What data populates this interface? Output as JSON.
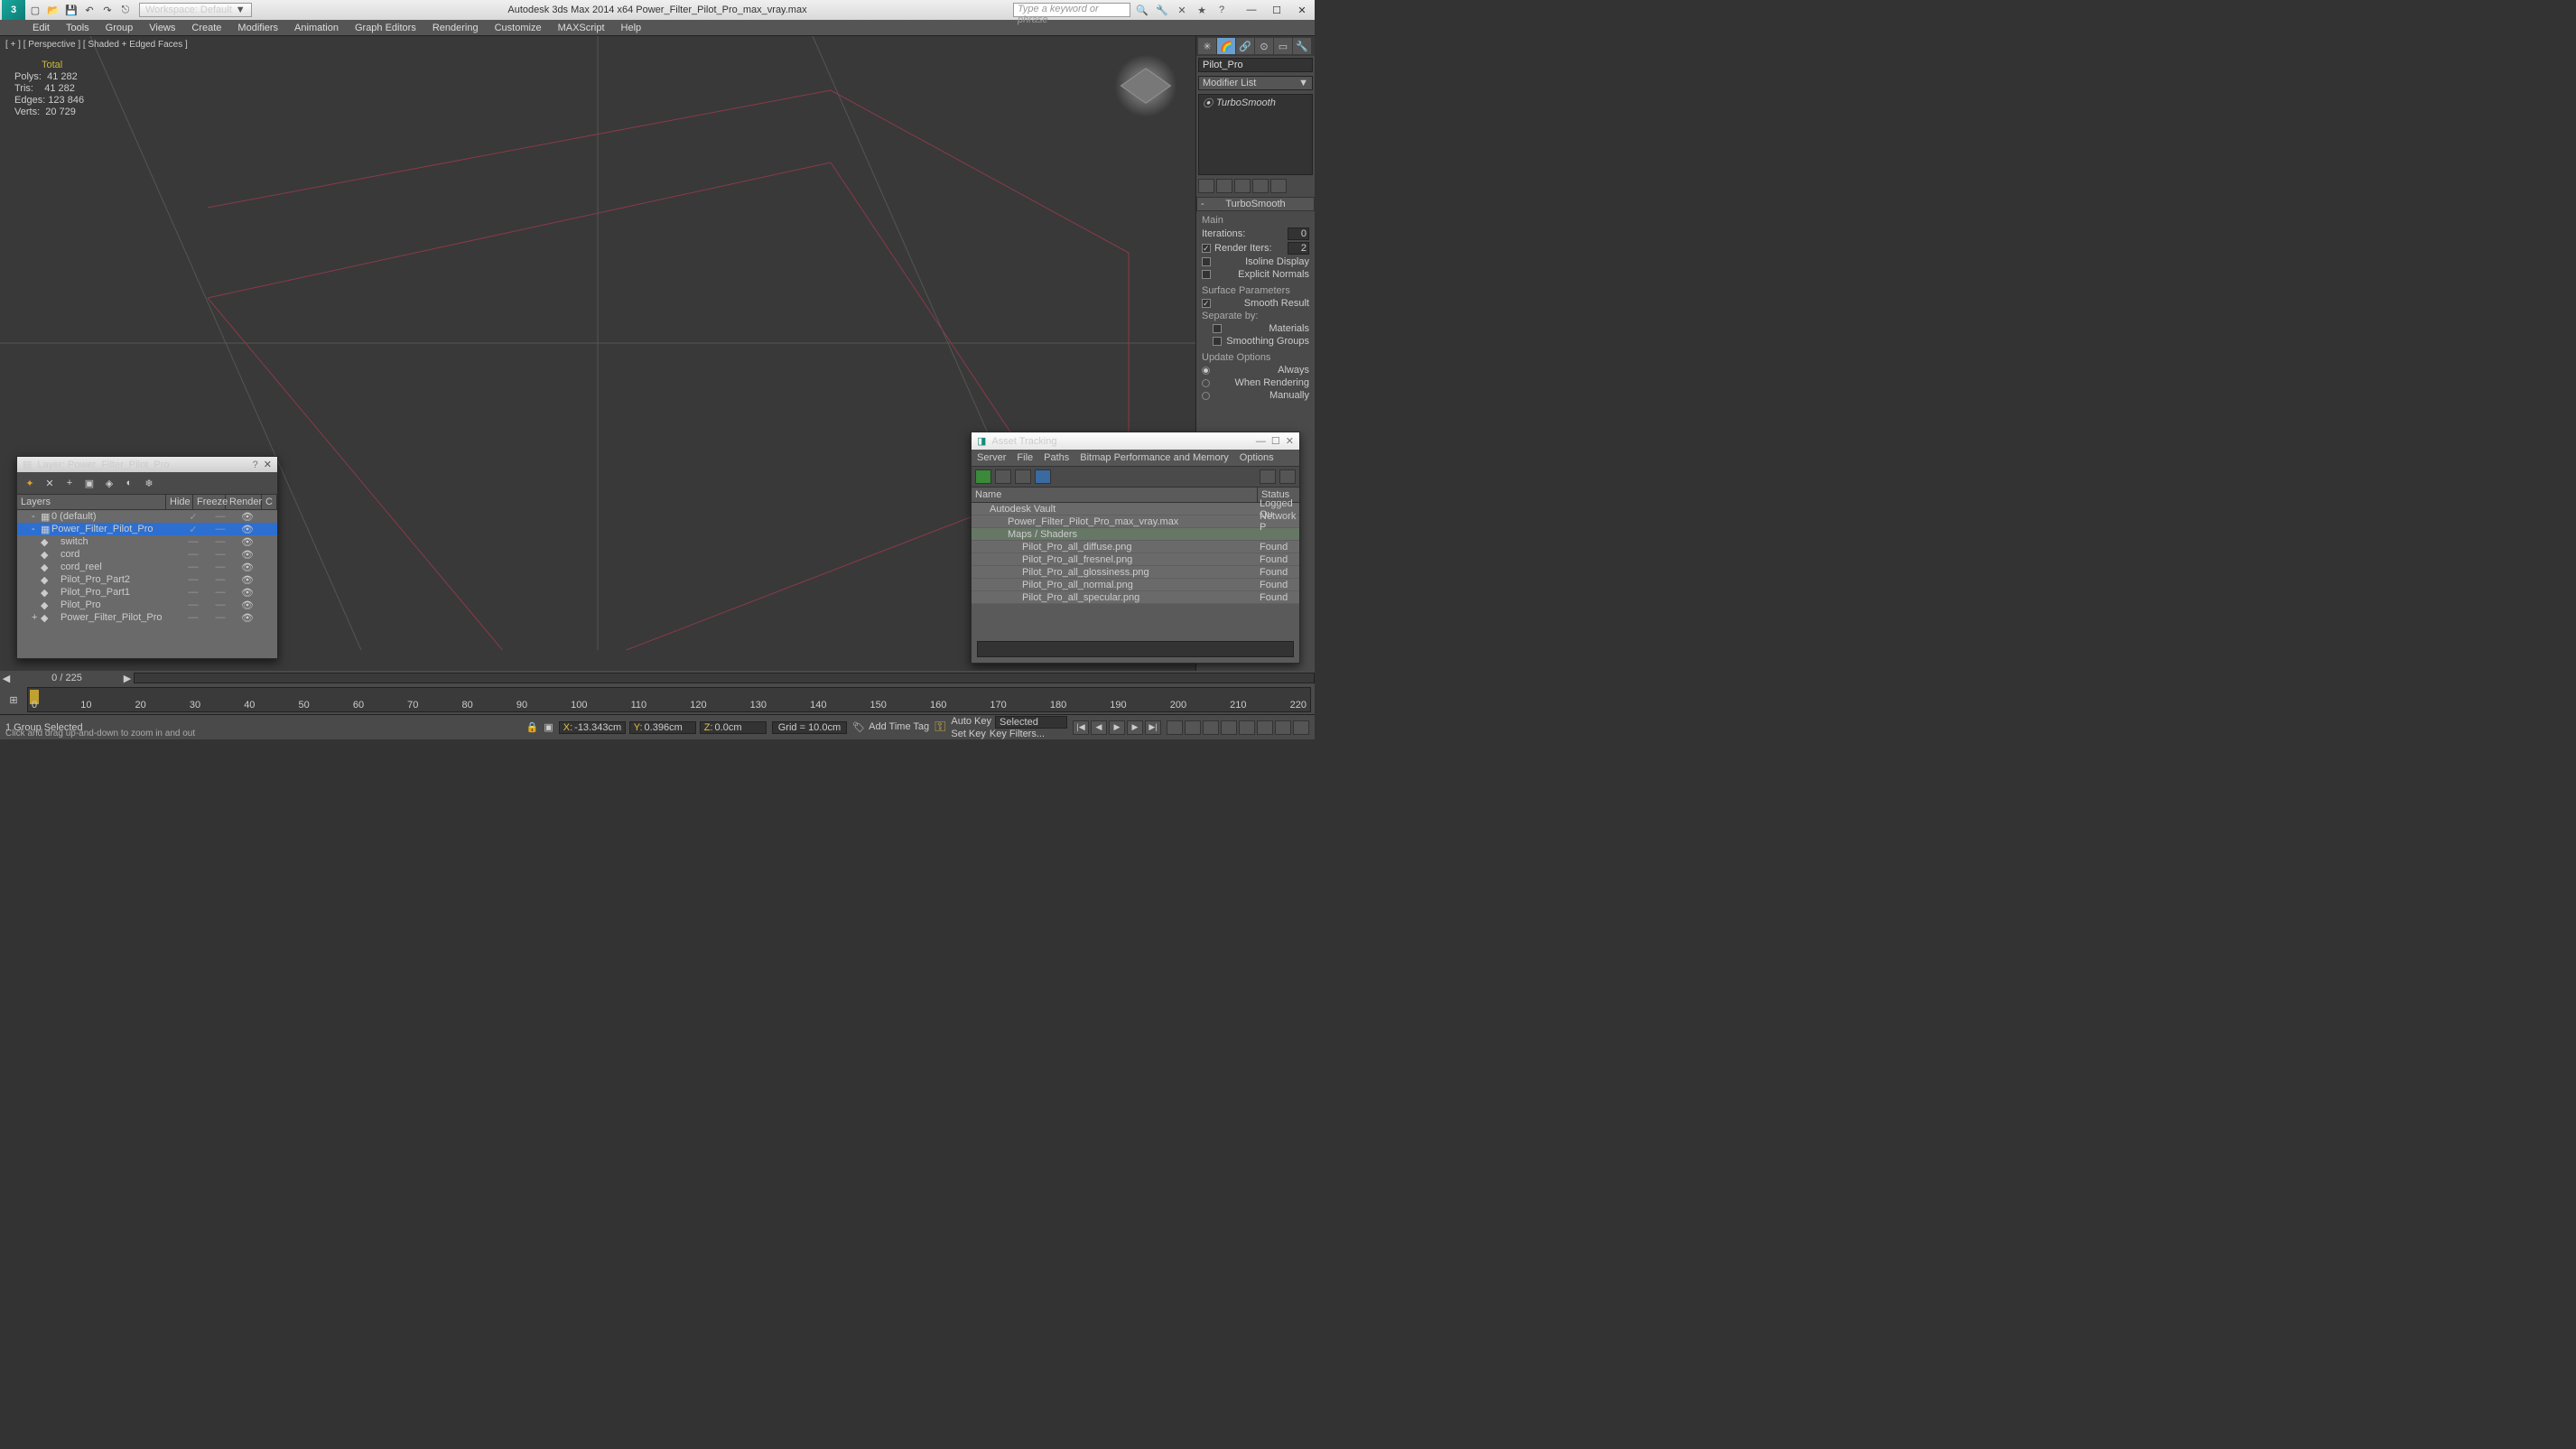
{
  "titlebar": {
    "workspace_label": "Workspace: Default",
    "center_title": "Autodesk 3ds Max  2014 x64    Power_Filter_Pilot_Pro_max_vray.max",
    "search_placeholder": "Type a keyword or phrase"
  },
  "menu": [
    "Edit",
    "Tools",
    "Group",
    "Views",
    "Create",
    "Modifiers",
    "Animation",
    "Graph Editors",
    "Rendering",
    "Customize",
    "MAXScript",
    "Help"
  ],
  "viewport": {
    "label": "[ + ] [ Perspective ] [ Shaded + Edged Faces ]",
    "stats_header": "Total",
    "stats": [
      {
        "k": "Polys:",
        "v": "41 282"
      },
      {
        "k": "Tris:",
        "v": "41 282"
      },
      {
        "k": "Edges:",
        "v": "123 846"
      },
      {
        "k": "Verts:",
        "v": "20 729"
      }
    ]
  },
  "cmd": {
    "object_name": "Pilot_Pro",
    "modifier_list_label": "Modifier List",
    "stack_item": "TurboSmooth",
    "rollout_title": "TurboSmooth",
    "group_main": "Main",
    "iterations_label": "Iterations:",
    "iterations_value": "0",
    "render_iters_label": "Render Iters:",
    "render_iters_value": "2",
    "isoline_label": "Isoline Display",
    "explicit_label": "Explicit Normals",
    "surface_params": "Surface Parameters",
    "smooth_result": "Smooth Result",
    "separate": "Separate by:",
    "materials": "Materials",
    "smoothing_groups": "Smoothing Groups",
    "update_options": "Update Options",
    "always": "Always",
    "when_rendering": "When Rendering",
    "manually": "Manually"
  },
  "layer_dialog": {
    "title": "Layer: Power_Filter_Pilot_Pro",
    "columns": {
      "layers": "Layers",
      "hide": "Hide",
      "freeze": "Freeze",
      "render": "Render",
      "c": "C"
    },
    "rows": [
      {
        "name": "0 (default)",
        "sel": false,
        "expand": "-",
        "icon": "▦",
        "check": true
      },
      {
        "name": "Power_Filter_Pilot_Pro",
        "sel": true,
        "expand": "-",
        "icon": "▦",
        "check": true
      },
      {
        "name": "switch",
        "sel": false,
        "expand": "",
        "icon": "◆",
        "indent": true
      },
      {
        "name": "cord",
        "sel": false,
        "expand": "",
        "icon": "◆",
        "indent": true
      },
      {
        "name": "cord_reel",
        "sel": false,
        "expand": "",
        "icon": "◆",
        "indent": true
      },
      {
        "name": "Pilot_Pro_Part2",
        "sel": false,
        "expand": "",
        "icon": "◆",
        "indent": true
      },
      {
        "name": "Pilot_Pro_Part1",
        "sel": false,
        "expand": "",
        "icon": "◆",
        "indent": true
      },
      {
        "name": "Pilot_Pro",
        "sel": false,
        "expand": "",
        "icon": "◆",
        "indent": true
      },
      {
        "name": "Power_Filter_Pilot_Pro",
        "sel": false,
        "expand": "+",
        "icon": "◆",
        "indent": true
      }
    ]
  },
  "asset_dialog": {
    "title": "Asset Tracking",
    "menu": [
      "Server",
      "File",
      "Paths",
      "Bitmap Performance and Memory",
      "Options"
    ],
    "columns": {
      "name": "Name",
      "status": "Status"
    },
    "rows": [
      {
        "name": "Autodesk Vault",
        "status": "Logged Ou",
        "cls": "indent1 group0"
      },
      {
        "name": "Power_Filter_Pilot_Pro_max_vray.max",
        "status": "Network P",
        "cls": "indent2"
      },
      {
        "name": "Maps / Shaders",
        "status": "",
        "cls": "indent2 group"
      },
      {
        "name": "Pilot_Pro_all_diffuse.png",
        "status": "Found",
        "cls": "indent3"
      },
      {
        "name": "Pilot_Pro_all_fresnel.png",
        "status": "Found",
        "cls": "indent3"
      },
      {
        "name": "Pilot_Pro_all_glossiness.png",
        "status": "Found",
        "cls": "indent3"
      },
      {
        "name": "Pilot_Pro_all_normal.png",
        "status": "Found",
        "cls": "indent3"
      },
      {
        "name": "Pilot_Pro_all_specular.png",
        "status": "Found",
        "cls": "indent3"
      }
    ]
  },
  "timeline": {
    "frame_info": "0 / 225",
    "ticks": [
      "0",
      "10",
      "20",
      "30",
      "40",
      "50",
      "60",
      "70",
      "80",
      "90",
      "100",
      "110",
      "120",
      "130",
      "140",
      "150",
      "160",
      "170",
      "180",
      "190",
      "200",
      "210",
      "220"
    ]
  },
  "status": {
    "selection": "1 Group Selected",
    "prompt": "Click and drag up-and-down to zoom in and out",
    "x_label": "X:",
    "x_val": "-13.343cm",
    "y_label": "Y:",
    "y_val": "0.396cm",
    "z_label": "Z:",
    "z_val": "0.0cm",
    "grid": "Grid = 10.0cm",
    "autokey": "Auto Key",
    "setkey": "Set Key",
    "selected": "Selected",
    "keyfilters": "Key Filters...",
    "addtimetag": "Add Time Tag"
  }
}
